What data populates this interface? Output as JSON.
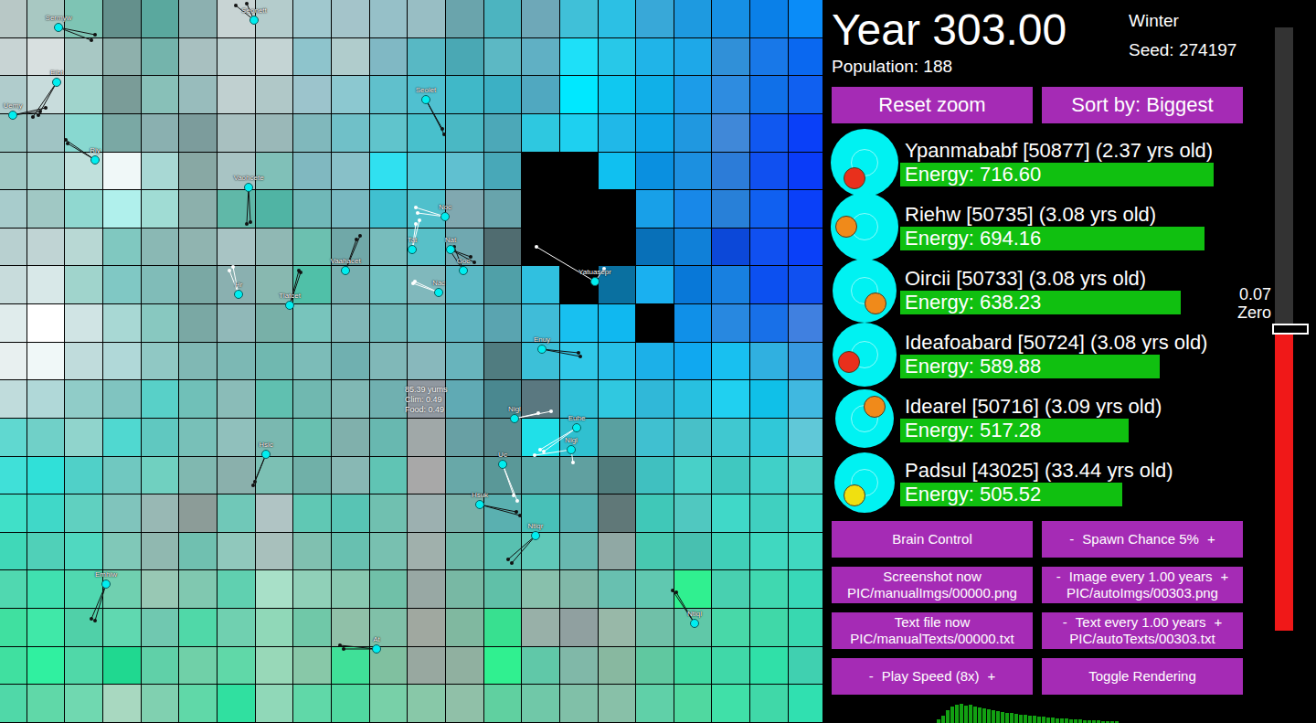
{
  "map": {
    "tiles": [
      [
        "#b8c8c6",
        "#a8c8c2",
        "#7ec4b4",
        "#64908c",
        "#5aa89e",
        "#8cb0b0",
        "#c8d4d4",
        "#b4cccc",
        "#a0c8ce",
        "#a4c4ca",
        "#96c0c8",
        "#98bec4",
        "#6aa4ac",
        "#4cb4c0",
        "#6ea8b8",
        "#40c0d8",
        "#2cc0e4",
        "#38a8d8",
        "#1e9ae0",
        "#1690e4",
        "#0a80e8",
        "#0a8cf8"
      ],
      [
        "#c8d4d4",
        "#d8e0e0",
        "#a8c8c4",
        "#8eb0ac",
        "#74b4ac",
        "#a8c0c0",
        "#bcd0d0",
        "#c4d4d4",
        "#8ec4cc",
        "#b0cccc",
        "#80b8c4",
        "#58b8c4",
        "#4aa8b4",
        "#5cb8c4",
        "#60b0c4",
        "#1ee0f8",
        "#28c8e8",
        "#20b4e8",
        "#1ea8e8",
        "#3090d8",
        "#1878e8",
        "#0a68f0"
      ],
      [
        "#b0cccc",
        "#c8dcdc",
        "#a0d4cc",
        "#7a9c98",
        "#88c0b8",
        "#98bcbc",
        "#c0d0d0",
        "#b0c8c8",
        "#9cc4cc",
        "#8cc8d0",
        "#60c0cc",
        "#50c0d0",
        "#40b8c8",
        "#3cb0c4",
        "#50a8c0",
        "#00e8ff",
        "#10c8f0",
        "#10b0e8",
        "#1c9ce8",
        "#2e8ce0",
        "#1070e8",
        "#1060f0"
      ],
      [
        "#98c4c0",
        "#a0c4c4",
        "#88d8d0",
        "#7aa8a4",
        "#8ab0b0",
        "#7c9c9c",
        "#a8c0c0",
        "#9ab8b8",
        "#80b8bc",
        "#70c0c8",
        "#60c4cc",
        "#48c0cc",
        "#4ab8c4",
        "#4ca8b8",
        "#2ec8e0",
        "#1ed0f0",
        "#20b8e8",
        "#10a8e8",
        "#2098e0",
        "#4088d8",
        "#1058f0",
        "#0a40f8"
      ],
      [
        "#a0c8c4",
        "#a8d0cc",
        "#c0e0dc",
        "#f0f8f8",
        "#a8d8d4",
        "#88a8a4",
        "#a8c4c4",
        "#80c0b8",
        "#80b8c0",
        "#88c0c8",
        "#30e0f0",
        "#50c8d8",
        "#60c0d0",
        "#48a8b8",
        "#000000",
        "#000000",
        "#10c0f0",
        "#0a90e0",
        "#1c90e0",
        "#2c7cd8",
        "#1050f0",
        "#0a3cf8"
      ],
      [
        "#a8cccc",
        "#a0c8c4",
        "#90d8d0",
        "#b0f0ec",
        "#a0dcd4",
        "#8cb0ac",
        "#60b8a8",
        "#50b4a4",
        "#70b8b8",
        "#78b8c0",
        "#40c0d0",
        "#50c0cc",
        "#80a8b0",
        "#68a4ac",
        "#000000",
        "#000000",
        "#000000",
        "#18a0e8",
        "#1888e8",
        "#2880d8",
        "#1060f0",
        "#0a40f8"
      ],
      [
        "#b8d0d0",
        "#c0d4d4",
        "#b8d8d4",
        "#80c8c0",
        "#8ab8b4",
        "#90b4b0",
        "#a8c4c4",
        "#90b8b4",
        "#6cc0b0",
        "#70a8a8",
        "#78bcbc",
        "#58c0c8",
        "#70a8b0",
        "#506c70",
        "#000000",
        "#000000",
        "#000000",
        "#0870b8",
        "#1080d8",
        "#0c48d8",
        "#1050f0",
        "#0a40f8"
      ],
      [
        "#c8dcdc",
        "#d8e8e8",
        "#a0d4cc",
        "#80c8c4",
        "#80bcb8",
        "#7aa8a4",
        "#8ab0b0",
        "#88b8b0",
        "#50c0a8",
        "#78b0b0",
        "#70c0c0",
        "#80b8bc",
        "#5ab8c4",
        "#50a0a8",
        "#30c0e0",
        "#000000",
        "#0a70a0",
        "#1ab0f0",
        "#0878d8",
        "#1880e0",
        "#0c50f0",
        "#1050f0"
      ],
      [
        "#e0ecec",
        "#ffffff",
        "#d0e4e4",
        "#a8d8d4",
        "#88c8c0",
        "#7aa8a4",
        "#90b8b8",
        "#78b0a8",
        "#78c4bc",
        "#80b8b8",
        "#70b8b8",
        "#70bcc0",
        "#60b4c0",
        "#5aa4b0",
        "#40bcd8",
        "#18c0f0",
        "#10b8f0",
        "#000000",
        "#1090e8",
        "#2888e0",
        "#1870e8",
        "#4080e0"
      ],
      [
        "#e8f0f0",
        "#f0f8f8",
        "#c0dcdc",
        "#b0d8d8",
        "#90c8c4",
        "#80b8b4",
        "#7cb8b4",
        "#70b8b0",
        "#7cbcb8",
        "#70b0b0",
        "#80b8b8",
        "#88b8bc",
        "#68b4bc",
        "#507c80",
        "#3cc0d8",
        "#30c8e8",
        "#28c0e8",
        "#1cb0e8",
        "#10a8f0",
        "#18c0f0",
        "#30b0e0",
        "#3898e0"
      ],
      [
        "#c0dcdc",
        "#b0d8d8",
        "#90ccc8",
        "#80c4c0",
        "#58d0c8",
        "#70c0b8",
        "#8abcb8",
        "#60c0b0",
        "#70b8b0",
        "#80b8b4",
        "#70b0b0",
        "#9098a0",
        "#60aab4",
        "#4a8890",
        "#5a7880",
        "#30c0d8",
        "#30c8e0",
        "#30b8d8",
        "#28c0e0",
        "#20d0f0",
        "#10c0e8",
        "#40b8e0"
      ],
      [
        "#60d8d0",
        "#70d0c8",
        "#90d4cc",
        "#50d8d0",
        "#60c8c0",
        "#78c0b8",
        "#90c0bc",
        "#7ab8b0",
        "#68c0b0",
        "#80b0ac",
        "#68b8b0",
        "#a0a8a8",
        "#68a0a4",
        "#5a8c90",
        "#20e0e8",
        "#30c0d0",
        "#5aa0a0",
        "#40c0d0",
        "#48c0c8",
        "#40c8d0",
        "#30c8d8",
        "#60c8d8"
      ],
      [
        "#40e0d8",
        "#30e0d8",
        "#50d0c8",
        "#70c8c0",
        "#70d0c0",
        "#80b8b0",
        "#8ab0ac",
        "#7cc0b4",
        "#70b0a8",
        "#88b8b4",
        "#60c4b4",
        "#a8a8a8",
        "#68a8a8",
        "#5a9898",
        "#5aa8a8",
        "#60a0a0",
        "#507c7c",
        "#40c0c0",
        "#48d0c8",
        "#40c8c0",
        "#40d0c8",
        "#50d0c8"
      ],
      [
        "#40e0c8",
        "#40d8c8",
        "#60d0c0",
        "#80c4bc",
        "#98b8b4",
        "#8c9c98",
        "#70c8b8",
        "#b0c4c4",
        "#60c8b4",
        "#58c4b4",
        "#70c0b0",
        "#9cb0b0",
        "#78b0a8",
        "#5ab0b0",
        "#48c0b8",
        "#58b0b0",
        "#607878",
        "#40c8b8",
        "#50c8c0",
        "#40d8c8",
        "#40d0c0",
        "#40d8c8"
      ],
      [
        "#40d8b8",
        "#50d0b8",
        "#50d8c0",
        "#80c8b8",
        "#90b8b0",
        "#70c0b0",
        "#90c8bc",
        "#a8c0bc",
        "#80c0b0",
        "#68c0b0",
        "#78c0b0",
        "#a0b0ac",
        "#70b8a8",
        "#58c0b0",
        "#60c8b8",
        "#68b8b0",
        "#90a8a4",
        "#48c8b0",
        "#48c0b0",
        "#40d0b8",
        "#40d8c0",
        "#40d8c0"
      ],
      [
        "#50d8b0",
        "#40e0b0",
        "#50d8b0",
        "#70d0b0",
        "#98c8b4",
        "#80c8b0",
        "#60d0b0",
        "#a8e0c8",
        "#90d0b8",
        "#88c8b0",
        "#70c0a8",
        "#98a8a4",
        "#78b8a4",
        "#60c0a8",
        "#88c0ac",
        "#80b8a8",
        "#68c0b0",
        "#60c8b0",
        "#30f090",
        "#48d0b0",
        "#40d8b0",
        "#38d8b8"
      ],
      [
        "#40e0a0",
        "#40e8a8",
        "#50d0a8",
        "#60d8b0",
        "#70c8b0",
        "#50d8a8",
        "#70d0b0",
        "#90d8b8",
        "#70c8a8",
        "#90c0a8",
        "#80c0a8",
        "#a0a8a0",
        "#80b8a0",
        "#38e090",
        "#98b0a8",
        "#90a0a0",
        "#98b8a8",
        "#70c0a8",
        "#60c8a8",
        "#48d8a8",
        "#40d8a8",
        "#38d8b0"
      ],
      [
        "#40e0a0",
        "#30f0a0",
        "#50d8a8",
        "#20d890",
        "#60d0a8",
        "#70d0a8",
        "#60d8a8",
        "#98d8b8",
        "#88c8a8",
        "#40e098",
        "#80c0a0",
        "#98a8a0",
        "#90b0a0",
        "#30f090",
        "#60c8a8",
        "#80b8a8",
        "#88b8a0",
        "#60c8a0",
        "#40d8a0",
        "#40d8a8",
        "#30e0a8",
        "#40d0b0"
      ],
      [
        "#50d8a8",
        "#60d8a8",
        "#70d8b0",
        "#a8d8c0",
        "#80d0b0",
        "#60d8a8",
        "#30e0a0",
        "#90d8b8",
        "#60d8a8",
        "#50d8a0",
        "#78d0a8",
        "#88c8a8",
        "#90c0a8",
        "#60d0a0",
        "#70c8a8",
        "#80c0a8",
        "#88c0a8",
        "#60d0a8",
        "#50d8a0",
        "#40e0a8",
        "#40d8a8",
        "#30e0b0"
      ]
    ],
    "creatures": [
      {
        "name": "Sermyw",
        "line_color": "#111111"
      },
      {
        "name": "Seonett",
        "line_color": "#111111"
      },
      {
        "name": "Eibt",
        "line_color": "#111111"
      },
      {
        "name": "Uemy",
        "line_color": "#111111"
      },
      {
        "name": "Seolet",
        "line_color": "#111111"
      },
      {
        "name": "Riy",
        "line_color": "#111111"
      },
      {
        "name": "Vaohcete",
        "line_color": "#111111"
      },
      {
        "name": "Noc",
        "line_color": "#ffffff"
      },
      {
        "name": "Tat",
        "line_color": "#ffffff"
      },
      {
        "name": "Nat",
        "line_color": "#111111"
      },
      {
        "name": "Goc",
        "line_color": "#111111"
      },
      {
        "name": "Vaahacet",
        "line_color": "#111111"
      },
      {
        "name": "Yatuasepr",
        "line_color": "#ffffff"
      },
      {
        "name": "Hr",
        "line_color": "#ffffff"
      },
      {
        "name": "Tlatcet",
        "line_color": "#111111"
      },
      {
        "name": "Nac",
        "line_color": "#ffffff"
      },
      {
        "name": "Enuy",
        "line_color": "#111111"
      },
      {
        "name": "Nigl",
        "line_color": "#ffffff"
      },
      {
        "name": "Euhe",
        "line_color": "#ffffff"
      },
      {
        "name": "Nigl",
        "line_color": "#ffffff"
      },
      {
        "name": "Hsic",
        "line_color": "#111111"
      },
      {
        "name": "Uc",
        "line_color": "#ffffff"
      },
      {
        "name": "Hsuk",
        "line_color": "#111111"
      },
      {
        "name": "Ntiqr",
        "line_color": "#111111"
      },
      {
        "name": "Emhiw",
        "line_color": "#111111"
      },
      {
        "name": "Ntiql",
        "line_color": "#111111"
      },
      {
        "name": "At",
        "line_color": "#111111"
      }
    ],
    "tooltip": [
      "85.39 yums",
      "Clim: 0.49",
      "Food: 0.49"
    ]
  },
  "header": {
    "year": "Year 303.00",
    "season": "Winter",
    "seed": "Seed: 274197",
    "population": "Population: 188"
  },
  "top_buttons": [
    "Reset zoom",
    "Sort by: Biggest"
  ],
  "leaderboard": [
    {
      "name": "Ypanmababf [50877] (2.37 yrs old)",
      "energy": "Energy: 716.60",
      "level": 0.94,
      "body_level": 1,
      "mouth_angle": 124,
      "color": "#e8301c"
    },
    {
      "name": "Riehw [50735] (3.08 yrs old)",
      "energy": "Energy: 694.16",
      "level": 0.91,
      "body_level": 1,
      "mouth_angle": 180,
      "color": "#f08a1a"
    },
    {
      "name": "Oircii [50733] (3.08 yrs old)",
      "energy": "Energy: 638.23",
      "level": 0.84,
      "body_level": 0.95,
      "mouth_angle": 49,
      "color": "#f08a1a"
    },
    {
      "name": "Ideafoabard [50724] (3.08 yrs old)",
      "energy": "Energy: 589.88",
      "level": 0.775,
      "body_level": 0.95,
      "mouth_angle": 155,
      "color": "#e8301c"
    },
    {
      "name": "Idearel [50716] (3.09 yrs old)",
      "energy": "Energy: 517.28",
      "level": 0.68,
      "body_level": 0.87,
      "mouth_angle": 311,
      "color": "#f08a1a"
    },
    {
      "name": "Padsul [43025] (33.44 yrs old)",
      "energy": "Energy: 505.52",
      "level": 0.66,
      "body_level": 0.89,
      "mouth_angle": 128,
      "color": "#f0e010"
    }
  ],
  "slider": {
    "labels": [
      "0.07",
      "Zero"
    ],
    "level": 0.5
  },
  "controls": [
    {
      "kind": "button",
      "label": "Brain Control"
    },
    {
      "kind": "stepper",
      "minus": "-",
      "label": "Spawn Chance 5%",
      "plus": "+"
    },
    {
      "kind": "button",
      "label": "Screenshot now",
      "sub": "PIC/manualImgs/00000.png"
    },
    {
      "kind": "stepper",
      "minus": "-",
      "label": "Image every 1.00 years",
      "plus": "+",
      "sub": "PIC/autoImgs/00303.png"
    },
    {
      "kind": "button",
      "label": "Text file now",
      "sub": "PIC/manualTexts/00000.txt"
    },
    {
      "kind": "stepper",
      "minus": "-",
      "label": "Text every 1.00 years",
      "plus": "+",
      "sub": "PIC/autoTexts/00303.txt"
    },
    {
      "kind": "stepper",
      "minus": "-",
      "label": "Play Speed (8x)",
      "plus": "+"
    },
    {
      "kind": "button",
      "label": "Toggle Rendering"
    }
  ],
  "histogram": {
    "values": [
      4,
      8,
      14,
      18,
      20,
      21,
      19,
      20,
      18,
      17,
      16,
      15,
      14,
      13,
      12,
      11,
      11,
      10,
      9,
      9,
      8,
      8,
      7,
      7,
      6,
      6,
      5,
      5,
      5,
      4,
      4,
      4,
      3,
      3,
      3,
      3,
      2,
      2,
      2,
      2
    ]
  }
}
